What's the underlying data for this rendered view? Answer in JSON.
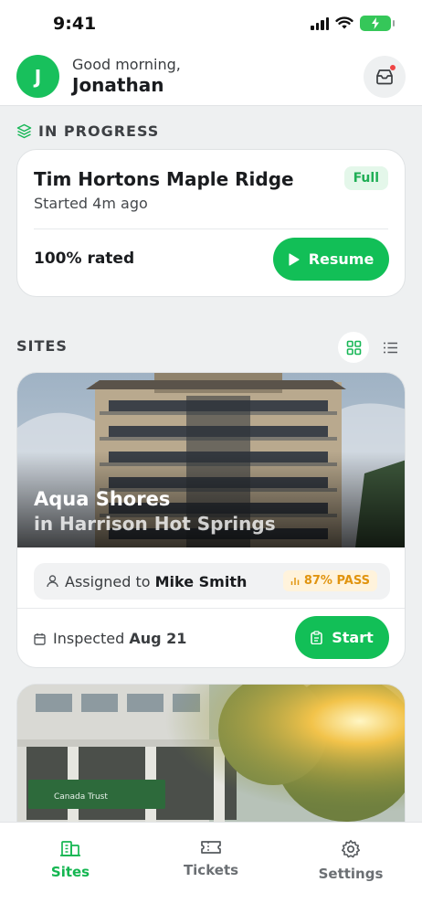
{
  "status": {
    "time": "9:41"
  },
  "header": {
    "avatar_initial": "J",
    "greeting": "Good morning,",
    "name": "Jonathan"
  },
  "in_progress": {
    "section_label": "IN PROGRESS",
    "card": {
      "title": "Tim Hortons Maple Ridge",
      "started": "Started 4m ago",
      "badge": "Full",
      "rated": "100% rated",
      "resume_label": "Resume"
    }
  },
  "sites": {
    "section_label": "SITES",
    "view_modes": [
      "grid-icon",
      "list-icon"
    ],
    "active_view": "grid",
    "items": [
      {
        "name": "Aqua Shores",
        "location": "in Harrison Hot Springs",
        "assigned_prefix": "Assigned to",
        "assigned_name": "Mike Smith",
        "pass_badge": "87% PASS",
        "inspected_prefix": "Inspected",
        "inspected_date": "Aug 21",
        "start_label": "Start"
      },
      {
        "sign_text": "Canada Trust"
      }
    ]
  },
  "tabbar": {
    "tabs": [
      {
        "label": "Sites",
        "icon": "building-icon",
        "active": true
      },
      {
        "label": "Tickets",
        "icon": "ticket-icon",
        "active": false
      },
      {
        "label": "Settings",
        "icon": "gear-icon",
        "active": false
      }
    ]
  },
  "colors": {
    "accent": "#12bf57",
    "pass": "#e1940f",
    "notification": "#ef4444"
  }
}
